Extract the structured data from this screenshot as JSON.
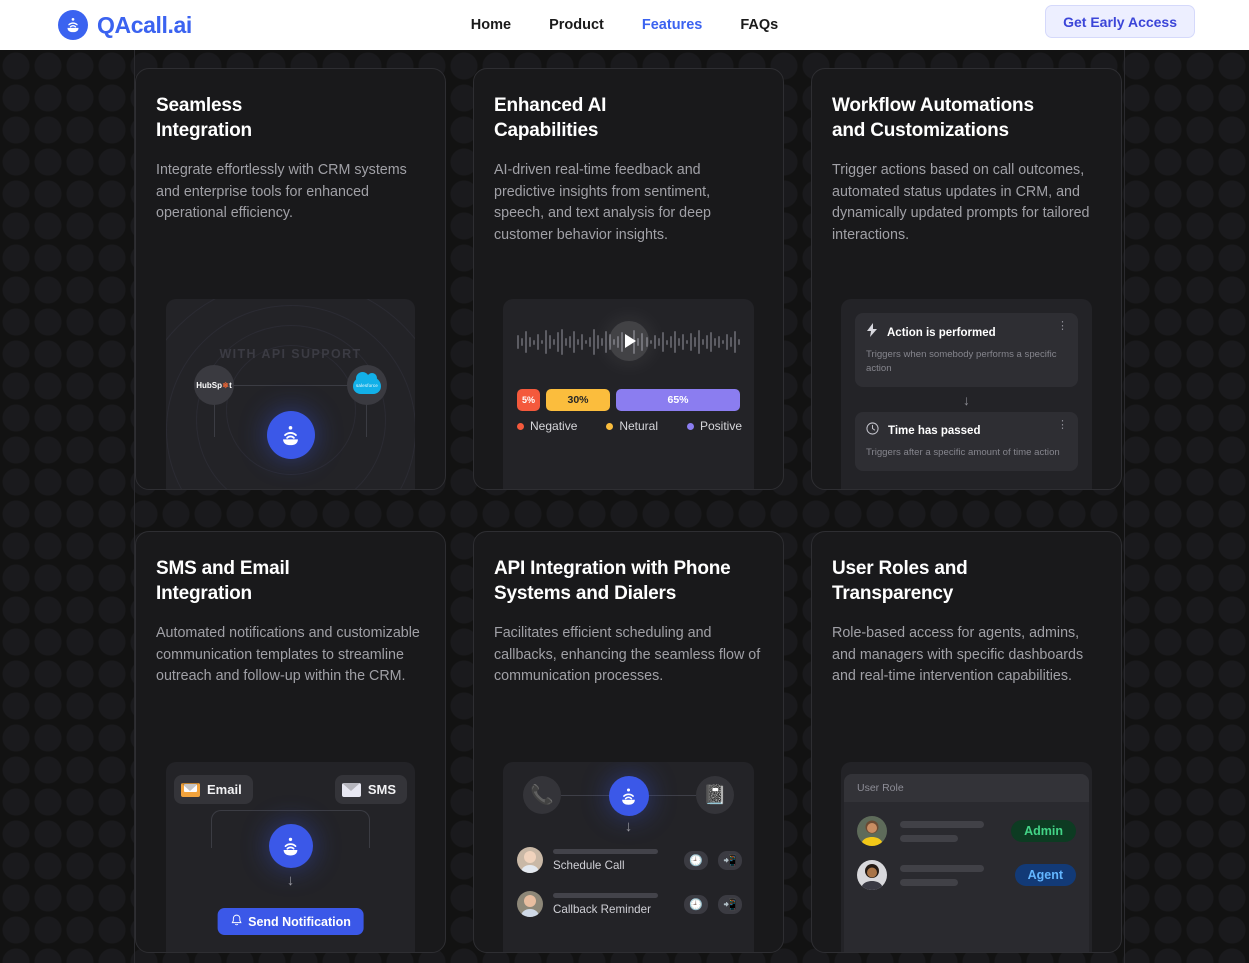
{
  "nav": {
    "brand": "QAcall.ai",
    "logo_icon": "call-wifi-logo-icon",
    "links": [
      {
        "label": "Home",
        "active": false
      },
      {
        "label": "Product",
        "active": false
      },
      {
        "label": "Features",
        "active": true
      },
      {
        "label": "FAQs",
        "active": false
      }
    ],
    "cta_label": "Get Early Access",
    "accent_color": "#3b63f0",
    "cta_bg": "#edefff",
    "cta_text_color": "#3b45d8"
  },
  "cards": [
    {
      "title": "Seamless\nIntegration",
      "desc": "Integrate effortlessly with CRM systems and enterprise tools for enhanced operational efficiency.",
      "visual": {
        "type": "integration-radar",
        "caption": "WITH API SUPPORT",
        "nodes": [
          "HubSpot",
          "salesforce"
        ],
        "center_icon": "qacall-logo-icon"
      }
    },
    {
      "title": "Enhanced AI\nCapabilities",
      "desc": "AI-driven real-time feedback and predictive insights from sentiment, speech, and text analysis for deep customer behavior insights.",
      "visual": {
        "type": "sentiment-waveform",
        "play_icon": "play-icon",
        "segments": [
          {
            "label": "5%",
            "value": 5,
            "color": "#f4593c",
            "legend": "Negative"
          },
          {
            "label": "30%",
            "value": 30,
            "color": "#fbbd3d",
            "legend": "Netural"
          },
          {
            "label": "65%",
            "value": 65,
            "color": "#8b7df0",
            "legend": "Positive"
          }
        ]
      }
    },
    {
      "title": "Workflow Automations\nand Customizations",
      "desc": "Trigger actions based on call outcomes, automated status updates in CRM, and dynamically updated prompts for tailored interactions.",
      "visual": {
        "type": "workflow-steps",
        "steps": [
          {
            "icon": "lightning-icon",
            "title": "Action is performed",
            "sub": "Triggers when somebody performs a specific action"
          },
          {
            "icon": "clock-icon",
            "title": "Time has passed",
            "sub": "Triggers after a specific amount of time action"
          }
        ],
        "connector_icon": "arrow-down-icon",
        "menu_icon": "kebab-menu-icon"
      }
    },
    {
      "title": "SMS and Email\nIntegration",
      "desc": "Automated notifications and customizable communication templates to streamline outreach and follow-up within the CRM.",
      "visual": {
        "type": "sms-email-flow",
        "chips": [
          {
            "label": "Email",
            "icon": "email-envelope-icon"
          },
          {
            "label": "SMS",
            "icon": "sms-envelope-icon"
          }
        ],
        "center_icon": "qacall-logo-icon",
        "action_label": "Send Notification",
        "action_icon": "bell-icon"
      }
    },
    {
      "title": "API Integration with Phone\nSystems and Dialers",
      "desc": "Facilitates efficient scheduling and callbacks, enhancing the seamless flow of communication processes.",
      "visual": {
        "type": "dialer-flow",
        "left_icon": "ringing-phone-icon",
        "right_icon": "phone-directory-icon",
        "center_icon": "qacall-logo-icon",
        "rows": [
          {
            "label": "Schedule Call",
            "avatar": "woman-avatar",
            "actions": [
              "clock-icon",
              "callback-phone-icon"
            ]
          },
          {
            "label": "Callback Reminder",
            "avatar": "man-avatar",
            "actions": [
              "clock-icon",
              "callback-phone-icon"
            ]
          }
        ]
      }
    },
    {
      "title": "User Roles and\nTransparency",
      "desc": "Role-based access for agents, admins, and managers with specific dashboards and real-time intervention capabilities.",
      "visual": {
        "type": "user-roles-table",
        "header": "User Role",
        "rows": [
          {
            "avatar": "woman-yellow-avatar",
            "badge": "Admin",
            "badge_color": "#43d487"
          },
          {
            "avatar": "woman-dark-avatar",
            "badge": "Agent",
            "badge_color": "#63b6ff"
          }
        ]
      }
    }
  ]
}
